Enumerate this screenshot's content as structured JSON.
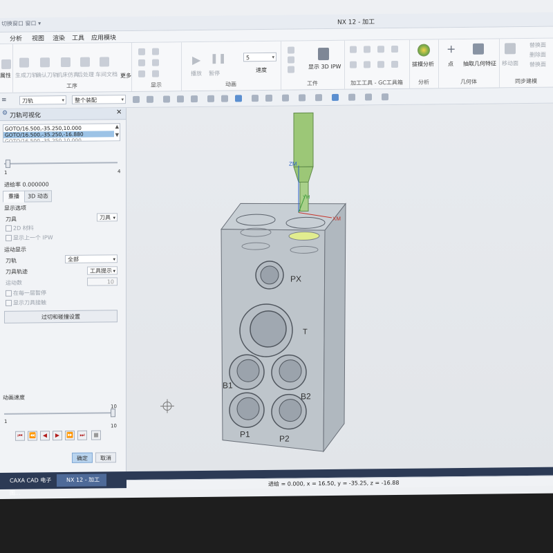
{
  "window": {
    "title": "NX 12 - 加工",
    "quick_access": "切换窗口  窗口 ▾"
  },
  "menu": {
    "items": [
      "分析",
      "视图",
      "渲染",
      "工具",
      "应用模块"
    ]
  },
  "ribbon": {
    "left_label": "属性",
    "group_process": {
      "label": "工序",
      "items": [
        "生成刀轨",
        "确认刀轨",
        "机床仿真",
        "后处理",
        "车间文档"
      ]
    },
    "more_label": "更多",
    "group_display": {
      "label": "显示"
    },
    "group_animation": {
      "label": "动画",
      "items": [
        "播放",
        "暂停"
      ],
      "speed_value": "5",
      "speed_label": "速度"
    },
    "group_workpiece": {
      "label": "工件",
      "show_ipw": "显示 3D IPW"
    },
    "group_cam_tools": {
      "label": "加工工具 - GC工具箱"
    },
    "group_analysis": {
      "label": "分析",
      "draft_analysis": "拔模分析"
    },
    "group_geometry": {
      "label": "几何体",
      "point": "点",
      "extract_feature": "抽取几何特征"
    },
    "group_sync": {
      "label": "同步建模",
      "move_face": "移动面",
      "items": [
        "替换面",
        "删除面",
        "替换面"
      ]
    }
  },
  "command_bar": {
    "filter_value": "刀轨",
    "assembly_value": "整个装配"
  },
  "panel": {
    "title": "刀轨可视化",
    "goto_lines": [
      "GOTO/16.500,-35.250,10.000",
      "GOTO/16.500,-35.250,-16.880",
      "GOTO/16.500,-35.250,10.000"
    ],
    "slider": {
      "min": "1",
      "max": "4",
      "value": 1
    },
    "feed_rate": "进给率 0.000000",
    "tabs": [
      "重播",
      "3D 动态"
    ],
    "display_options": "显示选项",
    "tool_label": "刀具",
    "tool_value": "刀具",
    "chk_2d_material": "2D 材料",
    "chk_show_prev_ipw": "显示上一个 IPW",
    "motion_display": "运动显示",
    "toolpath_label": "刀轨",
    "toolpath_value": "全部",
    "tool_trace_label": "刀具轨迹",
    "tool_trace_value": "工具提示",
    "motion_count_label": "运动数",
    "motion_count_value": "10",
    "chk_pause_each_step": "在每一层暂停",
    "chk_show_tool_contact": "显示刀具接触",
    "overcut_button": "过切和碰撞设置",
    "anim_speed_label": "动画速度",
    "anim_speed": {
      "min": "1",
      "max": "10",
      "value": 10
    },
    "ok": "确定",
    "cancel": "取消"
  },
  "viewport": {
    "part_labels": [
      "PX",
      "T",
      "B1",
      "B2",
      "P1",
      "P2"
    ],
    "axes": [
      "ZM",
      "YM",
      "XM"
    ]
  },
  "taskbar": {
    "items": [
      "CAXA CAD 电子图...",
      "NX 12 - 加工"
    ]
  },
  "status": {
    "text": "进给 = 0.000, x = 16.50, y = -35.25, z = -16.88"
  }
}
